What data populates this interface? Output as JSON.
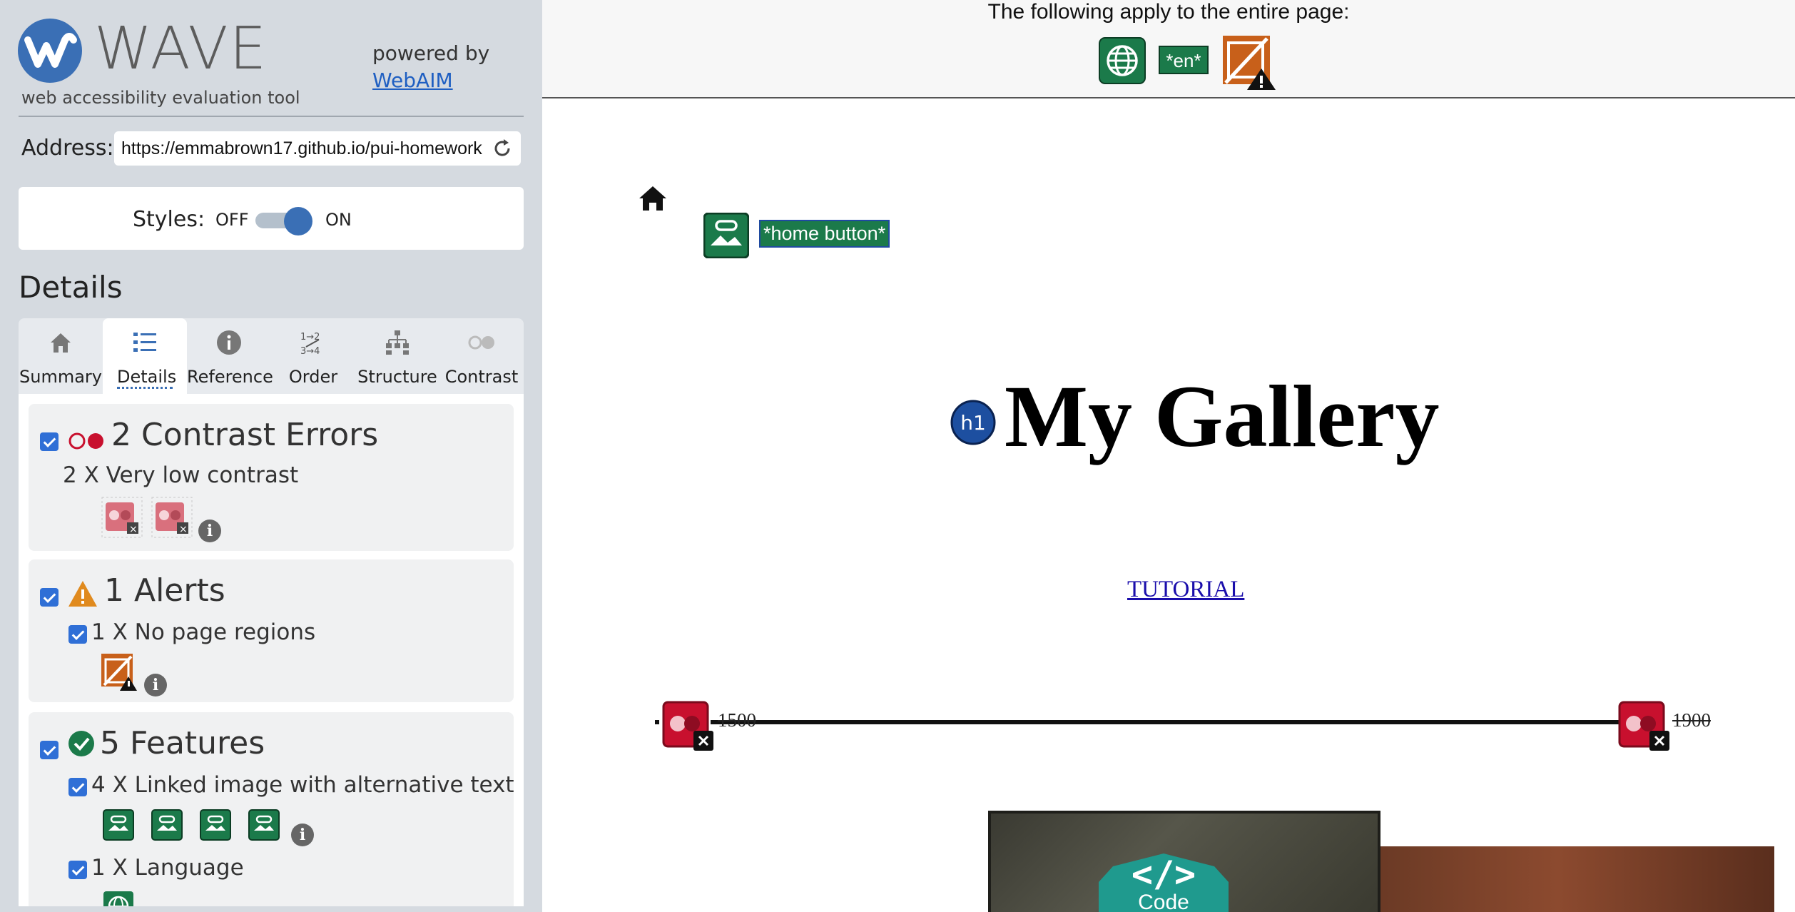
{
  "wave": {
    "logo_text": "WAVE",
    "tagline": "web accessibility evaluation tool",
    "powered_by": "powered by",
    "webaim_link": "WebAIM",
    "address_label": "Address:",
    "address_value": "https://emmabrown17.github.io/pui-homework",
    "styles_label": "Styles:",
    "styles_off": "OFF",
    "styles_on": "ON",
    "styles_enabled": true,
    "details_heading": "Details",
    "tabs": [
      {
        "label": "Summary",
        "icon": "home-icon"
      },
      {
        "label": "Details",
        "icon": "list-icon",
        "active": true
      },
      {
        "label": "Reference",
        "icon": "info-icon"
      },
      {
        "label": "Order",
        "icon": "order-icon"
      },
      {
        "label": "Structure",
        "icon": "structure-icon"
      },
      {
        "label": "Contrast",
        "icon": "contrast-icon"
      }
    ],
    "groups": {
      "contrast": {
        "title": "2 Contrast Errors",
        "checked": true,
        "items": [
          {
            "label": "2 X Very low contrast",
            "count": 2
          }
        ]
      },
      "alerts": {
        "title": "1 Alerts",
        "checked": true,
        "items": [
          {
            "label": "1 X No page regions",
            "count": 1,
            "checked": true
          }
        ]
      },
      "features": {
        "title": "5 Features",
        "checked": true,
        "items": [
          {
            "label": "4 X Linked image with alternative text",
            "count": 4,
            "checked": true
          },
          {
            "label": "1 X Language",
            "count": 1,
            "checked": true
          }
        ]
      }
    }
  },
  "page": {
    "topbar_text": "The following apply to the entire page:",
    "lang_badge": "*en*",
    "home_label": "*home button*",
    "h1_badge": "h1",
    "title": "My Gallery",
    "tutorial_link": "TUTORIAL",
    "timeline_start": "1500",
    "timeline_end": "1900",
    "code_glyph": "</>",
    "code_text": "Code"
  },
  "colors": {
    "wave_blue": "#3a6fb5",
    "feature_green": "#1b7a4a",
    "error_red": "#c8102e",
    "alert_orange": "#e08a1e",
    "sidebar_bg": "#d5dae0"
  }
}
